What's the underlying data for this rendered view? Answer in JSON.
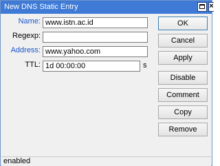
{
  "window": {
    "title": "New DNS Static Entry"
  },
  "form": {
    "name_label": "Name:",
    "name_value": "www.istn.ac.id",
    "regexp_label": "Regexp:",
    "regexp_value": "",
    "address_label": "Address:",
    "address_value": "www.yahoo.com",
    "ttl_label": "TTL:",
    "ttl_value": "1d 00:00:00",
    "ttl_unit": "s"
  },
  "buttons": {
    "ok": "OK",
    "cancel": "Cancel",
    "apply": "Apply",
    "disable": "Disable",
    "comment": "Comment",
    "copy": "Copy",
    "remove": "Remove"
  },
  "status": {
    "text": "enabled"
  },
  "colors": {
    "titlebar": "#3e7ad6",
    "label_blue": "#1a56c8"
  }
}
